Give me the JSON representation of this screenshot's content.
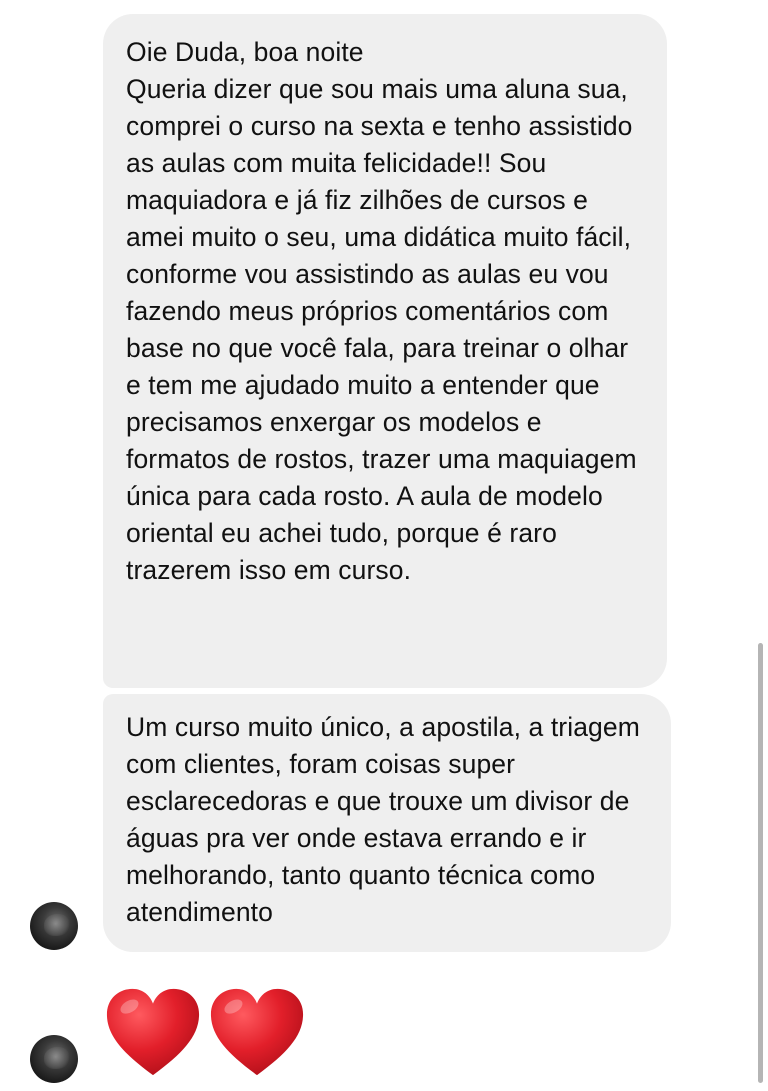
{
  "messages": [
    {
      "text": "Oie Duda, boa noite\nQueria dizer que sou mais uma aluna sua, comprei o curso na sexta e tenho assistido as aulas com muita felicidade!! Sou maquiadora e já fiz zilhões de cursos e amei muito o seu, uma didática muito fácil, conforme vou assistindo as aulas eu vou fazendo meus próprios comentários com base no que você fala, para treinar o olhar e tem me ajudado muito a entender que precisamos enxergar os modelos e formatos de rostos, trazer uma maquiagem única para cada rosto. A aula de modelo oriental eu achei tudo, porque é raro trazerem isso em curso."
    },
    {
      "text": "Um curso muito único, a apostila, a triagem com clientes, foram coisas super esclarecedoras e que trouxe um divisor de águas pra ver onde estava errando e ir melhorando, tanto quanto técnica como atendimento"
    }
  ],
  "reaction": {
    "icons": [
      "heart-emoji",
      "heart-emoji"
    ],
    "color": "#e0202a"
  },
  "colors": {
    "bubble_background": "#efefef",
    "text": "#111111",
    "page_background": "#ffffff"
  }
}
